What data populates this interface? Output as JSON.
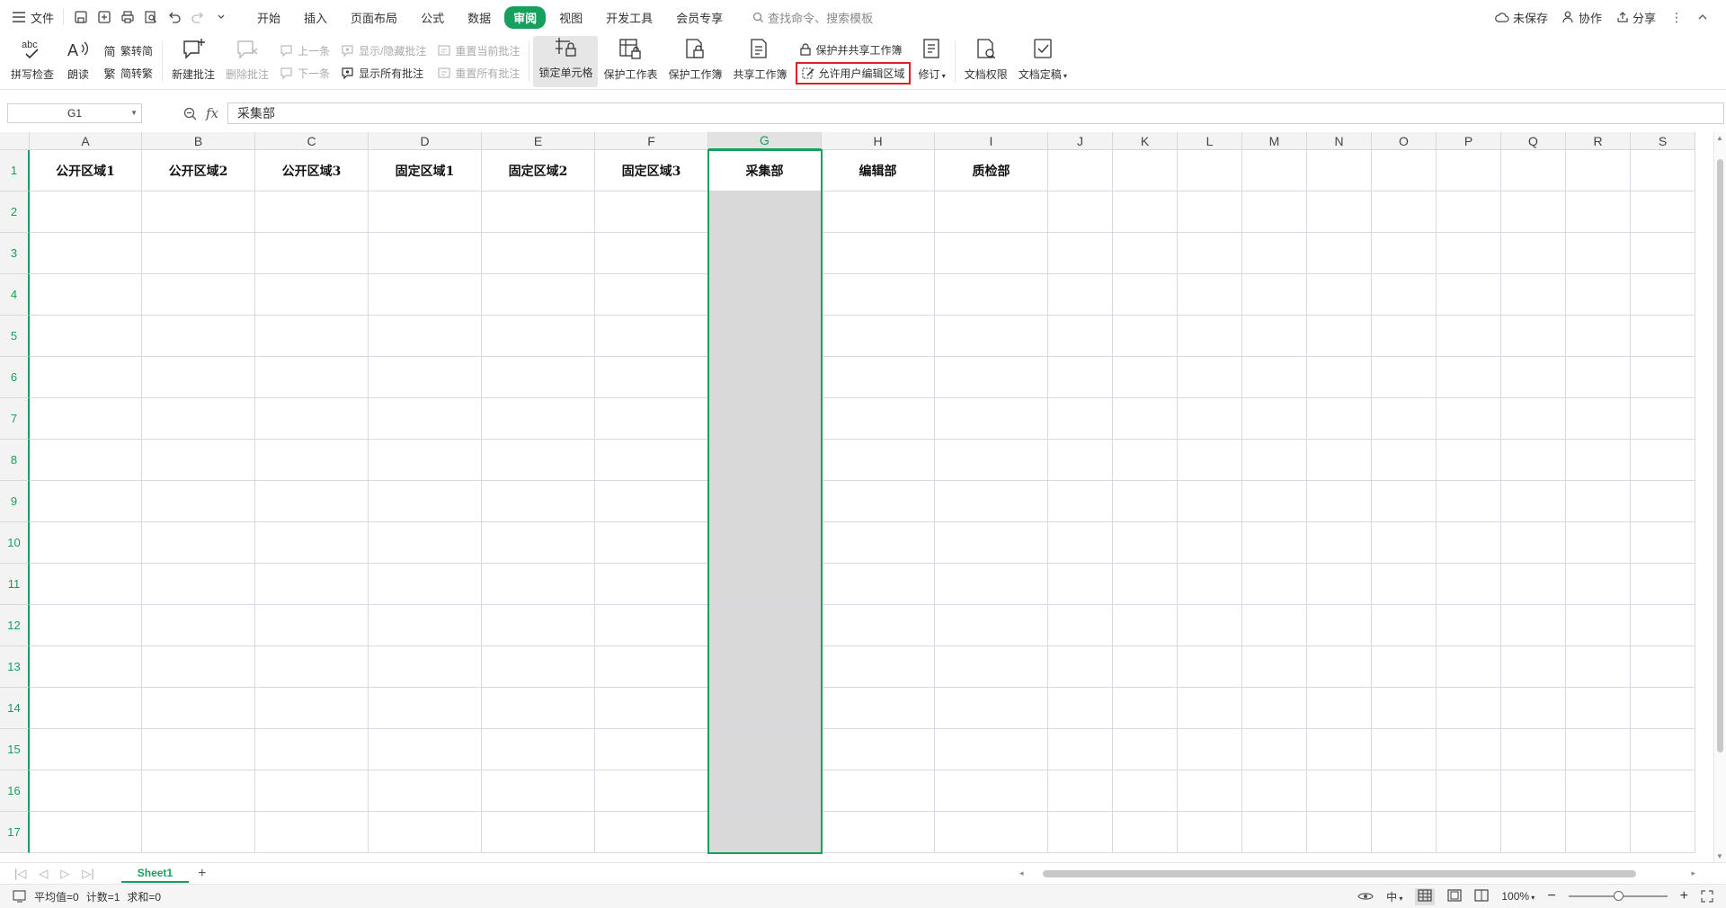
{
  "menubar": {
    "file_label": "文件",
    "tabs": [
      {
        "label": "开始",
        "active": false
      },
      {
        "label": "插入",
        "active": false
      },
      {
        "label": "页面布局",
        "active": false
      },
      {
        "label": "公式",
        "active": false
      },
      {
        "label": "数据",
        "active": false
      },
      {
        "label": "审阅",
        "active": true
      },
      {
        "label": "视图",
        "active": false
      },
      {
        "label": "开发工具",
        "active": false
      },
      {
        "label": "会员专享",
        "active": false
      }
    ],
    "search_text": "查找命令、搜索模板",
    "unsaved_label": "未保存",
    "collab_label": "协作",
    "share_label": "分享",
    "accent_color": "#17a05d"
  },
  "ribbon": {
    "spellcheck": "拼写检查",
    "read_aloud": "朗读",
    "trad_to_simp": "繁转简",
    "simp_to_trad": "简转繁",
    "new_comment": "新建批注",
    "delete_comment": "删除批注",
    "prev_comment": "上一条",
    "next_comment": "下一条",
    "show_hide_comment": "显示/隐藏批注",
    "show_all_comments": "显示所有批注",
    "reset_current_comment": "重置当前批注",
    "reset_all_comments": "重置所有批注",
    "lock_cell": "锁定单元格",
    "protect_sheet": "保护工作表",
    "protect_workbook": "保护工作簿",
    "share_workbook": "共享工作簿",
    "protect_share_workbook": "保护并共享工作簿",
    "allow_edit_ranges": "允许用户编辑区域",
    "track_changes": "修订",
    "doc_permissions": "文档权限",
    "doc_finalize": "文档定稿",
    "highlight_color": "#e0202a"
  },
  "formula_bar": {
    "name_box": "G1",
    "fx_label": "fx",
    "content": "采集部"
  },
  "sheet": {
    "columns": [
      "A",
      "B",
      "C",
      "D",
      "E",
      "F",
      "G",
      "H",
      "I",
      "J",
      "K",
      "L",
      "M",
      "N",
      "O",
      "P",
      "Q",
      "R",
      "S"
    ],
    "rows": [
      "1",
      "2",
      "3",
      "4",
      "5",
      "6",
      "7",
      "8",
      "9",
      "10",
      "11",
      "12",
      "13",
      "14",
      "15",
      "16",
      "17"
    ],
    "row1": [
      "公开区域1",
      "公开区域2",
      "公开区域3",
      "固定区域1",
      "固定区域2",
      "固定区域3",
      "采集部",
      "编辑部",
      "质检部",
      "",
      "",
      "",
      "",
      "",
      "",
      "",
      "",
      "",
      ""
    ],
    "selected_column": "G",
    "selection_fill": "#d9d9d9"
  },
  "sheet_tabs": {
    "tabs": [
      "Sheet1"
    ],
    "add_label": "+"
  },
  "statusbar": {
    "average": "平均值=0",
    "count": "计数=1",
    "sum": "求和=0",
    "input_mode": "中",
    "zoom": "100%",
    "zoom_fraction": 0.5
  }
}
